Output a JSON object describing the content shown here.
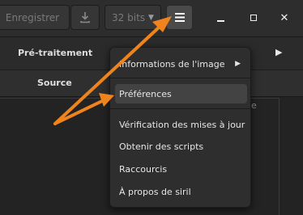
{
  "toolbar": {
    "save_label": "Enregistrer",
    "bits_label": "32 bits",
    "download_icon": "download-icon",
    "menu_icon": "hamburger-menu-icon"
  },
  "window_controls": {
    "close_glyph": "✕"
  },
  "tabs": {
    "pre_traitement": "Pré-traitement",
    "source": "Source"
  },
  "menu": {
    "items": [
      {
        "label": "Informations de l'image",
        "has_submenu": true
      },
      {
        "label": "Préférences",
        "highlighted": true
      },
      {
        "label": "Vérification des mises à jour"
      },
      {
        "label": "Obtenir des scripts"
      },
      {
        "label": "Raccourcis"
      },
      {
        "label": "À propos de siril"
      }
    ]
  },
  "background_peek_text": "e",
  "colors": {
    "annotation_arrow": "#f0841c",
    "background": "#262626",
    "menu_bg": "#2e2e2e",
    "menu_highlight": "#434343"
  }
}
